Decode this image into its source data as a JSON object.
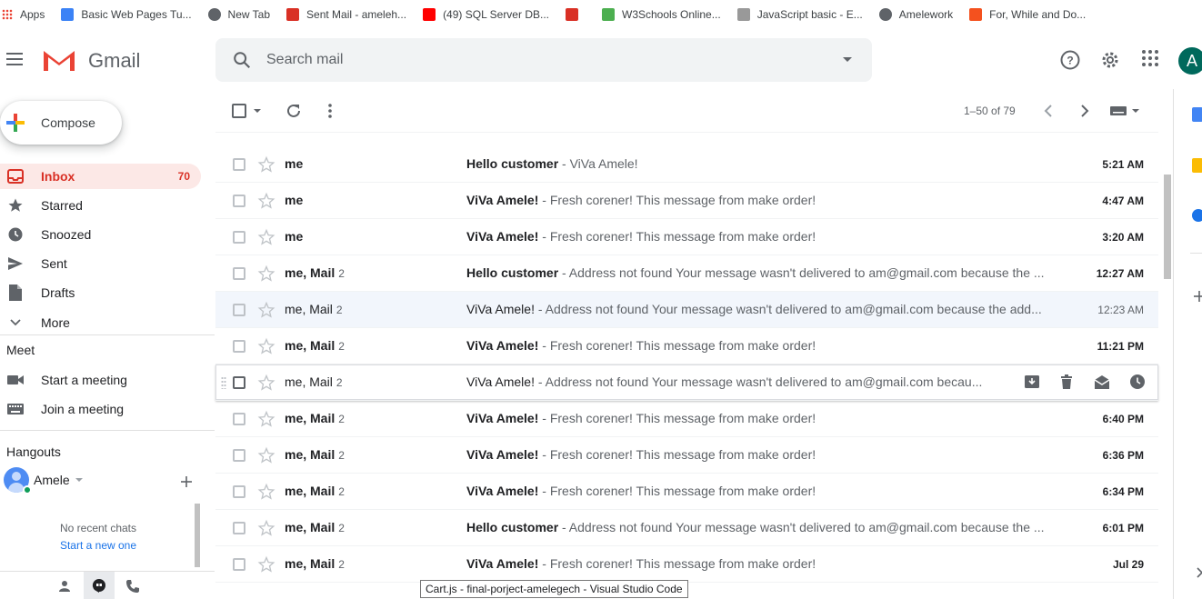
{
  "bookmarks": [
    {
      "label": "Apps",
      "icon": "apps-grid-icon",
      "color": "#ea4335"
    },
    {
      "label": "Basic Web Pages Tu...",
      "icon": "bookmark-site-icon",
      "color": "#3b82f6"
    },
    {
      "label": "New Tab",
      "icon": "globe-icon",
      "color": "#5f6368"
    },
    {
      "label": "Sent Mail - ameleh...",
      "icon": "gmail-icon",
      "color": "#d93025"
    },
    {
      "label": "(49) SQL Server DB...",
      "icon": "youtube-icon",
      "color": "#ff0000"
    },
    {
      "label": "",
      "icon": "gmail-icon",
      "color": "#d93025"
    },
    {
      "label": "W3Schools Online...",
      "icon": "w3schools-icon",
      "color": "#4caf50"
    },
    {
      "label": "JavaScript basic - E...",
      "icon": "w3r-icon",
      "color": "#999999"
    },
    {
      "label": "Amelework",
      "icon": "globe-icon",
      "color": "#5f6368"
    },
    {
      "label": "For, While and Do...",
      "icon": "site-icon",
      "color": "#f4511e"
    }
  ],
  "header": {
    "app_name": "Gmail",
    "search_placeholder": "Search mail",
    "avatar_letter": "A"
  },
  "sidebar": {
    "compose_label": "Compose",
    "items": [
      {
        "label": "Inbox",
        "count": "70",
        "icon": "inbox-icon"
      },
      {
        "label": "Starred",
        "count": "",
        "icon": "star-icon"
      },
      {
        "label": "Snoozed",
        "count": "",
        "icon": "clock-icon"
      },
      {
        "label": "Sent",
        "count": "",
        "icon": "send-icon"
      },
      {
        "label": "Drafts",
        "count": "",
        "icon": "draft-icon"
      },
      {
        "label": "More",
        "count": "",
        "icon": "chevron-down-icon"
      }
    ],
    "meet": {
      "title": "Meet",
      "start": "Start a meeting",
      "join": "Join a meeting"
    },
    "hangouts": {
      "title": "Hangouts",
      "user": "Amele",
      "no_chats": "No recent chats",
      "start_new": "Start a new one"
    }
  },
  "toolbar": {
    "pager": "1–50 of 79"
  },
  "emails": [
    {
      "sender": "me",
      "sender_bold": "",
      "count": "",
      "subject": "Hello customer",
      "snippet": " - ViVa Amele!",
      "time": "5:21 AM",
      "state": "unread"
    },
    {
      "sender": "me",
      "sender_bold": "",
      "count": "",
      "subject": "ViVa Amele!",
      "snippet": " - Fresh corener! This message from make order!",
      "time": "4:47 AM",
      "state": "unread"
    },
    {
      "sender": "me",
      "sender_bold": "",
      "count": "",
      "subject": "ViVa Amele!",
      "snippet": " - Fresh corener! This message from make order!",
      "time": "3:20 AM",
      "state": "unread"
    },
    {
      "sender": "me, ",
      "sender_bold": "Mail",
      "count": "2",
      "subject": "Hello customer",
      "snippet": " - Address not found Your message wasn't delivered to am@gmail.com because the ...",
      "time": "12:27 AM",
      "state": "unread"
    },
    {
      "sender": "me, Mail",
      "sender_bold": "",
      "count": "2",
      "subject": "ViVa Amele!",
      "snippet": " - Address not found Your message wasn't delivered to am@gmail.com because the add...",
      "time": "12:23 AM",
      "state": "read"
    },
    {
      "sender": "me, ",
      "sender_bold": "Mail",
      "count": "2",
      "subject": "ViVa Amele!",
      "snippet": " - Fresh corener! This message from make order!",
      "time": "11:21 PM",
      "state": "unread"
    },
    {
      "sender": "me, Mail",
      "sender_bold": "",
      "count": "2",
      "subject": "ViVa Amele!",
      "snippet": " - Address not found Your message wasn't delivered to am@gmail.com becau...",
      "time": "",
      "state": "hover"
    },
    {
      "sender": "me, ",
      "sender_bold": "Mail",
      "count": "2",
      "subject": "ViVa Amele!",
      "snippet": " - Fresh corener! This message from make order!",
      "time": "6:40 PM",
      "state": "unread"
    },
    {
      "sender": "me, ",
      "sender_bold": "Mail",
      "count": "2",
      "subject": "ViVa Amele!",
      "snippet": " - Fresh corener! This message from make order!",
      "time": "6:36 PM",
      "state": "unread"
    },
    {
      "sender": "me, ",
      "sender_bold": "Mail",
      "count": "2",
      "subject": "ViVa Amele!",
      "snippet": " - Fresh corener! This message from make order!",
      "time": "6:34 PM",
      "state": "unread"
    },
    {
      "sender": "me, ",
      "sender_bold": "Mail",
      "count": "2",
      "subject": "Hello customer",
      "snippet": " - Address not found Your message wasn't delivered to am@gmail.com because the ...",
      "time": "6:01 PM",
      "state": "unread"
    },
    {
      "sender": "me, ",
      "sender_bold": "Mail",
      "count": "2",
      "subject": "ViVa Amele!",
      "snippet": " - Fresh corener! This message from make order!",
      "time": "Jul 29",
      "state": "unread"
    }
  ],
  "taskbar_tooltip": "Cart.js - final-porject-amelegech - Visual Studio Code",
  "colors": {
    "accent_red": "#d93025",
    "inbox_bg": "#fce8e6",
    "read_row_bg": "#f2f6fc"
  }
}
